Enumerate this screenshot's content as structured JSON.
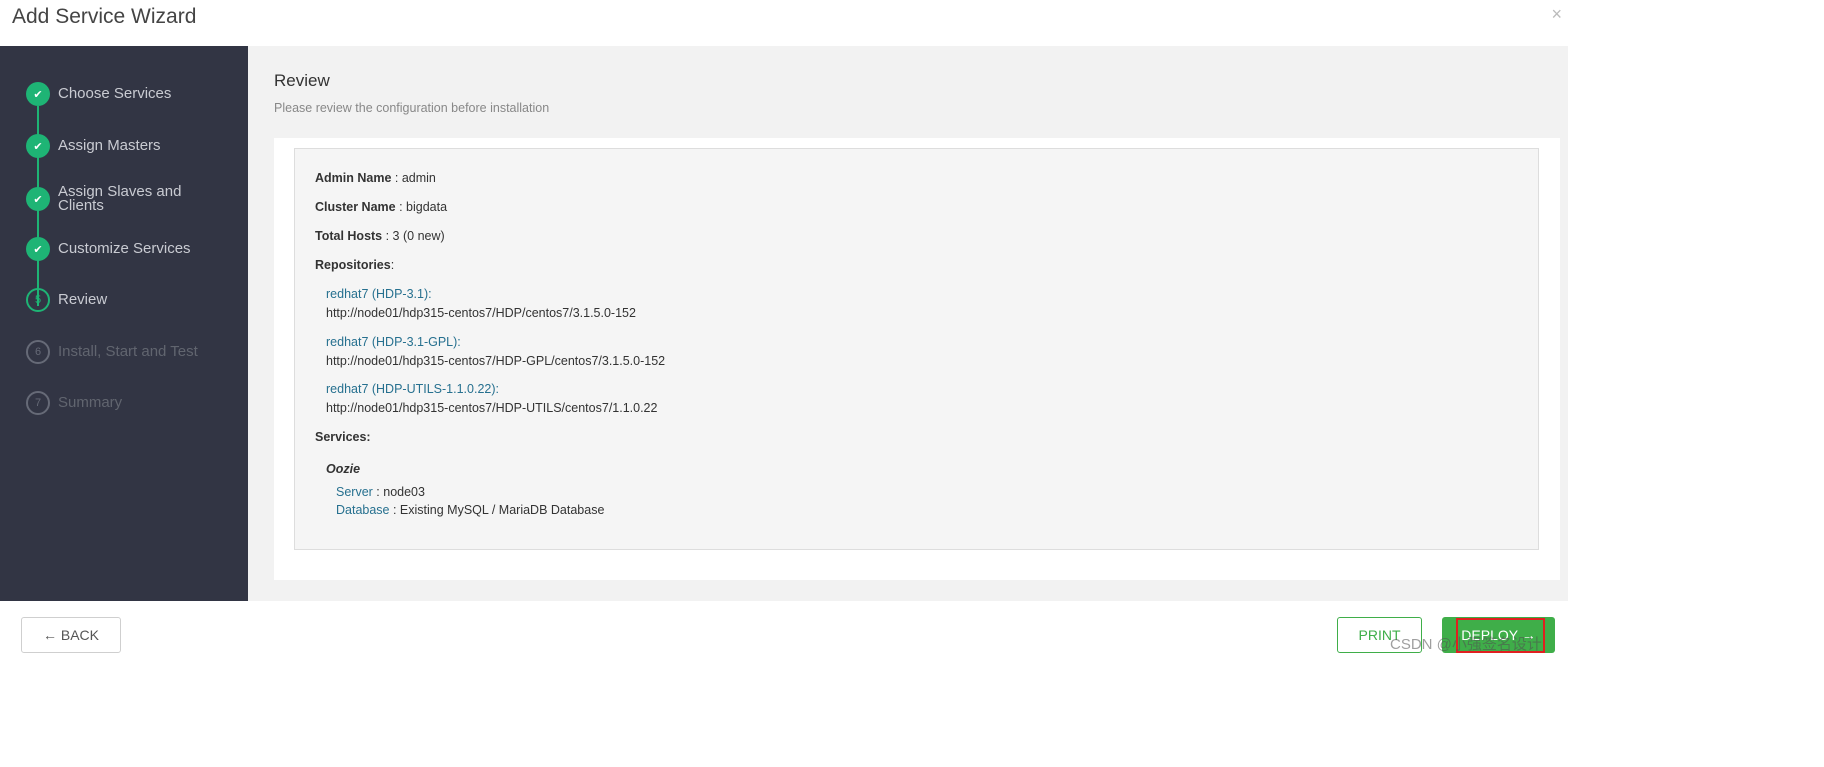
{
  "header": {
    "title": "Add Service Wizard",
    "close_icon": "×"
  },
  "sidebar": {
    "steps": [
      {
        "marker": "✔",
        "label": "Choose Services",
        "state": "done"
      },
      {
        "marker": "✔",
        "label": "Assign Masters",
        "state": "done"
      },
      {
        "marker": "✔",
        "label": "Assign Slaves and Clients",
        "state": "done"
      },
      {
        "marker": "✔",
        "label": "Customize Services",
        "state": "done"
      },
      {
        "marker": "5",
        "label": "Review",
        "state": "current"
      },
      {
        "marker": "6",
        "label": "Install, Start and Test",
        "state": "future"
      },
      {
        "marker": "7",
        "label": "Summary",
        "state": "future"
      }
    ]
  },
  "main": {
    "title": "Review",
    "subtitle": "Please review the configuration before installation",
    "admin": {
      "label": "Admin Name",
      "value": " : admin"
    },
    "cluster": {
      "label": "Cluster Name",
      "value": " : bigdata"
    },
    "hosts": {
      "label": "Total Hosts",
      "value": " : 3 (0 new)"
    },
    "repositories_label": "Repositories",
    "repositories_colon": ":",
    "repos": [
      {
        "name": "redhat7 (HDP-3.1):",
        "url": "http://node01/hdp315-centos7/HDP/centos7/3.1.5.0-152"
      },
      {
        "name": "redhat7 (HDP-3.1-GPL):",
        "url": "http://node01/hdp315-centos7/HDP-GPL/centos7/3.1.5.0-152"
      },
      {
        "name": "redhat7 (HDP-UTILS-1.1.0.22):",
        "url": "http://node01/hdp315-centos7/HDP-UTILS/centos7/1.1.0.22"
      }
    ],
    "services_label": "Services:",
    "service": {
      "name": "Oozie",
      "server_label": "Server",
      "server_value": " : node03",
      "database_label": "Database",
      "database_value": " : Existing MySQL / MariaDB Database"
    }
  },
  "footer": {
    "back_label": "← BACK",
    "print_label": "PRINT",
    "deploy_label": "DEPLOY →",
    "watermark": "CSDN @小强签名设计"
  },
  "colors": {
    "sidebar_bg": "#323544",
    "step_done": "#1EB475",
    "button_green": "#3FAE49",
    "link": "#26708f",
    "highlight": "#e02020"
  }
}
